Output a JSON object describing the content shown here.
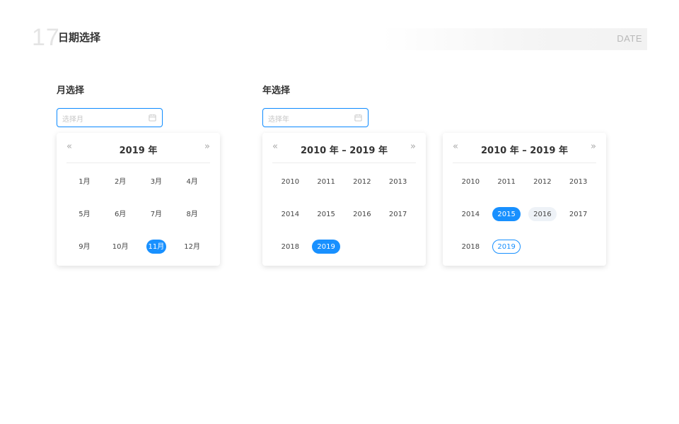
{
  "header": {
    "number": "17",
    "title": "日期选择",
    "tag": "DATE"
  },
  "month_section": {
    "label": "月选择",
    "input_placeholder": "选择月",
    "panel": {
      "title": "2019 年",
      "prev": "«",
      "next": "»",
      "months": [
        "1月",
        "2月",
        "3月",
        "4月",
        "5月",
        "6月",
        "7月",
        "8月",
        "9月",
        "10月",
        "11月",
        "12月"
      ],
      "selected": "11月"
    }
  },
  "year_section": {
    "label": "年选择",
    "input_placeholder": "选择年",
    "panel_a": {
      "title": "2010 年 – 2019 年",
      "prev": "«",
      "next": "»",
      "years": [
        "2010",
        "2011",
        "2012",
        "2013",
        "2014",
        "2015",
        "2016",
        "2017",
        "2018",
        "2019"
      ],
      "selected": "2019"
    },
    "panel_b": {
      "title": "2010 年 – 2019 年",
      "prev": "«",
      "next": "»",
      "years": [
        "2010",
        "2011",
        "2012",
        "2013",
        "2014",
        "2015",
        "2016",
        "2017",
        "2018",
        "2019"
      ],
      "selected": "2015",
      "hovered": "2016",
      "current": "2019"
    }
  },
  "colors": {
    "accent": "#1890ff",
    "hover_bg": "#eef2f7",
    "placeholder": "#c7c7c7"
  },
  "icons": {
    "input_suffix": "calendar-icon",
    "prev": "double-chevron-left-icon",
    "next": "double-chevron-right-icon"
  }
}
